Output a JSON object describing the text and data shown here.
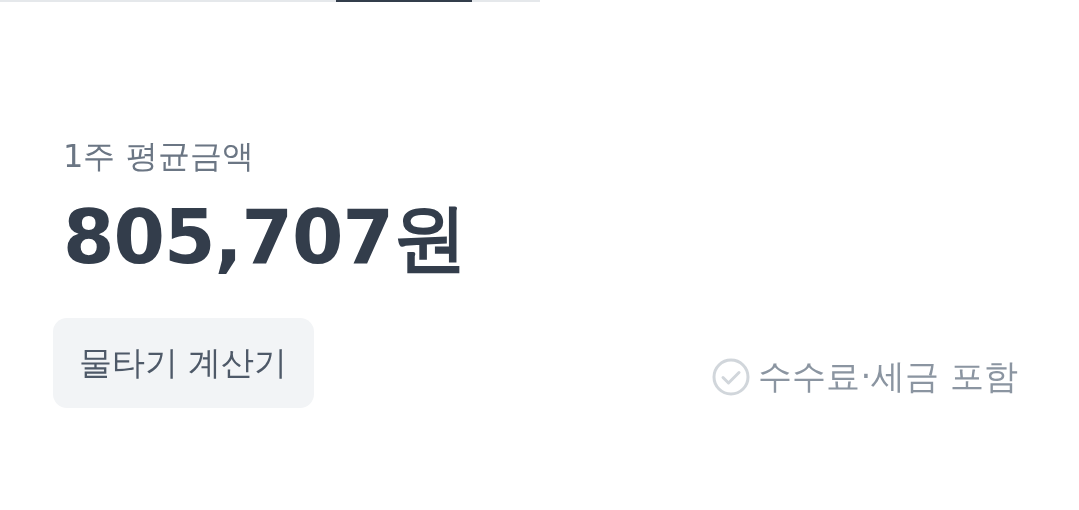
{
  "summary": {
    "label": "1주 평균금액",
    "amount": "805,707원"
  },
  "calculator_button": {
    "label": "물타기 계산기"
  },
  "fee_option": {
    "label": "수수료·세금 포함",
    "checked": false
  }
}
